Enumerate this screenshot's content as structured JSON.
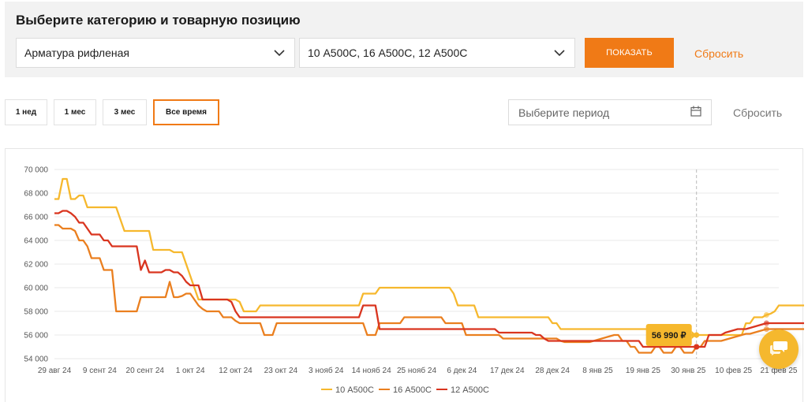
{
  "filters": {
    "title": "Выберите категорию и товарную позицию",
    "category_value": "Арматура рифленая",
    "positions_value": "10 А500С, 16 А500С, 12 А500С",
    "show_label": "ПОКАЗАТЬ",
    "reset_label": "Сбросить"
  },
  "range": {
    "buttons": [
      "1 нед",
      "1 мес",
      "3 мес",
      "Все время"
    ],
    "active": "Все время",
    "period_placeholder": "Выберите период",
    "reset_label": "Сбросить"
  },
  "icons": {
    "category_chevron": "chevron-down-icon",
    "positions_chevron": "chevron-down-icon",
    "calendar": "calendar-icon",
    "chat": "chat-icon"
  },
  "colors": {
    "accent": "#f07a16",
    "series_10": "#f6b82d",
    "series_16": "#ea7f1f",
    "series_12": "#d9351f"
  },
  "chart_data": {
    "type": "line",
    "x": [
      "29 авг 24",
      "30 авг 24",
      "31 авг 24",
      "1 сент 24",
      "2 сент 24",
      "3 сент 24",
      "4 сент 24",
      "5 сент 24",
      "6 сент 24",
      "7 сент 24",
      "8 сент 24",
      "9 сент 24",
      "10 сент 24",
      "11 сент 24",
      "12 сент 24",
      "13 сент 24",
      "14 сент 24",
      "15 сент 24",
      "16 сент 24",
      "17 сент 24",
      "18 сент 24",
      "19 сент 24",
      "20 сент 24",
      "21 сент 24",
      "22 сент 24",
      "23 сент 24",
      "24 сент 24",
      "25 сент 24",
      "26 сент 24",
      "27 сент 24",
      "28 сент 24",
      "29 сент 24",
      "30 сент 24",
      "1 окт 24",
      "2 окт 24",
      "3 окт 24",
      "4 окт 24",
      "5 окт 24",
      "6 окт 24",
      "7 окт 24",
      "8 окт 24",
      "9 окт 24",
      "10 окт 24",
      "11 окт 24",
      "12 окт 24",
      "13 окт 24",
      "14 окт 24",
      "15 окт 24",
      "16 окт 24",
      "17 окт 24",
      "18 окт 24",
      "19 окт 24",
      "20 окт 24",
      "21 окт 24",
      "22 окт 24",
      "23 окт 24",
      "24 окт 24",
      "25 окт 24",
      "26 окт 24",
      "27 окт 24",
      "28 окт 24",
      "29 окт 24",
      "30 окт 24",
      "31 окт 24",
      "1 нояб 24",
      "2 нояб 24",
      "3 нояб 24",
      "4 нояб 24",
      "5 нояб 24",
      "6 нояб 24",
      "7 нояб 24",
      "8 нояб 24",
      "9 нояб 24",
      "10 нояб 24",
      "11 нояб 24",
      "12 нояб 24",
      "13 нояб 24",
      "14 нояб 24",
      "15 нояб 24",
      "16 нояб 24",
      "17 нояб 24",
      "18 нояб 24",
      "19 нояб 24",
      "20 нояб 24",
      "21 нояб 24",
      "22 нояб 24",
      "23 нояб 24",
      "24 нояб 24",
      "25 нояб 24",
      "26 нояб 24",
      "27 нояб 24",
      "28 нояб 24",
      "29 нояб 24",
      "30 нояб 24",
      "1 дек 24",
      "2 дек 24",
      "3 дек 24",
      "4 дек 24",
      "5 дек 24",
      "6 дек 24",
      "7 дек 24",
      "8 дек 24",
      "9 дек 24",
      "10 дек 24",
      "11 дек 24",
      "12 дек 24",
      "13 дек 24",
      "14 дек 24",
      "15 дек 24",
      "16 дек 24",
      "17 дек 24",
      "18 дек 24",
      "19 дек 24",
      "20 дек 24",
      "21 дек 24",
      "22 дек 24",
      "23 дек 24",
      "24 дек 24",
      "25 дек 24",
      "26 дек 24",
      "27 дек 24",
      "28 дек 24",
      "29 дек 24",
      "30 дек 24",
      "31 дек 24",
      "1 янв 25",
      "2 янв 25",
      "3 янв 25",
      "4 янв 25",
      "5 янв 25",
      "6 янв 25",
      "7 янв 25",
      "8 янв 25",
      "9 янв 25",
      "10 янв 25",
      "11 янв 25",
      "12 янв 25",
      "13 янв 25",
      "14 янв 25",
      "15 янв 25",
      "16 янв 25",
      "17 янв 25",
      "18 янв 25",
      "19 янв 25",
      "20 янв 25",
      "21 янв 25",
      "22 янв 25",
      "23 янв 25",
      "24 янв 25",
      "25 янв 25",
      "26 янв 25",
      "27 янв 25",
      "28 янв 25",
      "29 янв 25",
      "30 янв 25",
      "31 янв 25",
      "1 фев 25",
      "2 фев 25",
      "3 фев 25",
      "4 фев 25",
      "5 фев 25",
      "6 фев 25",
      "7 фев 25",
      "8 фев 25",
      "9 фев 25",
      "10 фев 25",
      "11 фев 25",
      "12 фев 25",
      "13 фев 25",
      "14 фев 25",
      "15 фев 25",
      "16 фев 25",
      "17 фев 25",
      "18 фев 25",
      "19 фев 25",
      "20 фев 25",
      "21 фев 25"
    ],
    "x_tick_labels": [
      "29 авг 24",
      "9 сент 24",
      "20 сент 24",
      "1 окт 24",
      "12 окт 24",
      "23 окт 24",
      "3 нояб 24",
      "14 нояб 24",
      "25 нояб 24",
      "6 дек 24",
      "17 дек 24",
      "28 дек 24",
      "8 янв 25",
      "19 янв 25",
      "30 янв 25",
      "10 фев 25",
      "21 фев 25"
    ],
    "y_ticks": [
      "54 000",
      "56 000",
      "58 000",
      "60 000",
      "62 000",
      "64 000",
      "66 000",
      "68 000",
      "70 000"
    ],
    "ylim": [
      54000,
      70000
    ],
    "grid": true,
    "legend_position": "bottom",
    "series": [
      {
        "name": "10 А500С",
        "color": "#f6b82d",
        "values": [
          67500,
          67500,
          69200,
          69200,
          67500,
          67500,
          67800,
          67800,
          66800,
          66800,
          66800,
          66800,
          66800,
          66800,
          66800,
          66800,
          65800,
          64800,
          64800,
          64800,
          64800,
          64800,
          64800,
          64800,
          63200,
          63200,
          63200,
          63200,
          63200,
          63000,
          63000,
          63000,
          62000,
          61000,
          60000,
          59000,
          59000,
          59000,
          59000,
          59000,
          59000,
          59000,
          59000,
          59000,
          59000,
          58800,
          58000,
          58000,
          58000,
          58000,
          58500,
          58500,
          58500,
          58500,
          58500,
          58500,
          58500,
          58500,
          58500,
          58500,
          58500,
          58500,
          58500,
          58500,
          58500,
          58500,
          58500,
          58500,
          58500,
          58500,
          58500,
          58500,
          58500,
          58500,
          58500,
          59500,
          59500,
          59500,
          59500,
          60000,
          60000,
          60000,
          60000,
          60000,
          60000,
          60000,
          60000,
          60000,
          60000,
          60000,
          60000,
          60000,
          60000,
          60000,
          60000,
          60000,
          60000,
          59500,
          58500,
          58500,
          58500,
          58500,
          58500,
          57500,
          57500,
          57500,
          57500,
          57500,
          57500,
          57500,
          57500,
          57500,
          57500,
          57500,
          57500,
          57500,
          57500,
          57500,
          57500,
          57500,
          57500,
          57000,
          57000,
          56500,
          56500,
          56500,
          56500,
          56500,
          56500,
          56500,
          56500,
          56500,
          56500,
          56500,
          56500,
          56500,
          56500,
          56500,
          56500,
          56500,
          56500,
          56500,
          56500,
          56500,
          56500,
          56500,
          56500,
          56500,
          56500,
          56500,
          56500,
          56000,
          56000,
          56000,
          56000,
          56000,
          56000,
          56000,
          56000,
          56000,
          56000,
          56000,
          56000,
          56000,
          56000,
          56000,
          56000,
          56000,
          56990,
          56990,
          57500,
          57500,
          57500,
          57700,
          57800,
          58000,
          58500,
          58500,
          58500,
          58500,
          58500,
          58500,
          58500,
          58500,
          58500,
          58500,
          58500,
          58500,
          58500,
          58500,
          58500,
          58500,
          58500,
          58500,
          58500,
          58500,
          58500,
          58500,
          58500
        ]
      },
      {
        "name": "16 А500С",
        "color": "#ea7f1f",
        "values": [
          65300,
          65300,
          65000,
          65000,
          65000,
          64800,
          64000,
          64000,
          63500,
          62500,
          62500,
          62500,
          61500,
          61500,
          61500,
          58000,
          58000,
          58000,
          58000,
          58000,
          58000,
          59200,
          59200,
          59200,
          59200,
          59200,
          59200,
          59200,
          60500,
          59200,
          59200,
          59300,
          59500,
          59500,
          59000,
          58500,
          58200,
          58000,
          58000,
          58000,
          58000,
          57500,
          57500,
          57500,
          57200,
          57000,
          57000,
          57000,
          57000,
          57000,
          57000,
          56000,
          56000,
          56000,
          57000,
          57000,
          57000,
          57000,
          57000,
          57000,
          57000,
          57000,
          57000,
          57000,
          57000,
          57000,
          57000,
          57000,
          57000,
          57000,
          57000,
          57000,
          57000,
          57000,
          57000,
          57000,
          56000,
          56000,
          56000,
          57000,
          57000,
          57000,
          57000,
          57000,
          57000,
          57500,
          57500,
          57500,
          57500,
          57500,
          57500,
          57500,
          57500,
          57500,
          57500,
          57000,
          57000,
          57000,
          57000,
          57000,
          56000,
          56000,
          56000,
          56000,
          56000,
          56000,
          56000,
          56000,
          56000,
          55700,
          55700,
          55700,
          55700,
          55700,
          55700,
          55700,
          55700,
          55700,
          55700,
          55700,
          55700,
          55700,
          55700,
          55500,
          55400,
          55400,
          55400,
          55400,
          55400,
          55400,
          55400,
          55500,
          55600,
          55700,
          55800,
          55900,
          56000,
          56000,
          55500,
          55500,
          55000,
          55000,
          54500,
          54500,
          54500,
          54500,
          55000,
          55000,
          54500,
          54500,
          54500,
          55000,
          55000,
          54500,
          54500,
          54500,
          55000,
          55000,
          55500,
          55500,
          55500,
          55500,
          55500,
          55600,
          55700,
          55800,
          55900,
          56000,
          56100,
          56100,
          56200,
          56300,
          56400,
          56500,
          56500,
          56500,
          56500,
          56500,
          56500,
          56500,
          56500,
          56500,
          56500,
          56500,
          56500,
          56500,
          56500,
          56500,
          56500,
          56500,
          56500,
          56500,
          56500,
          56500,
          56500,
          56500
        ]
      },
      {
        "name": "12 А500С",
        "color": "#d9351f",
        "values": [
          66300,
          66300,
          66500,
          66500,
          66300,
          66000,
          65500,
          65500,
          65000,
          64500,
          64500,
          64500,
          64000,
          64000,
          63500,
          63500,
          63500,
          63500,
          63500,
          63500,
          63500,
          61500,
          62300,
          61300,
          61300,
          61300,
          61300,
          61500,
          61500,
          61300,
          61300,
          61000,
          60500,
          60200,
          60200,
          60200,
          59000,
          59000,
          59000,
          59000,
          59000,
          59000,
          59000,
          58800,
          58000,
          57500,
          57500,
          57500,
          57500,
          57500,
          57500,
          57500,
          57500,
          57500,
          57500,
          57500,
          57500,
          57500,
          57500,
          57500,
          57500,
          57500,
          57500,
          57500,
          57500,
          57500,
          57500,
          57500,
          57500,
          57500,
          57500,
          57500,
          57500,
          57500,
          57500,
          58500,
          58500,
          58500,
          58500,
          56500,
          56500,
          56500,
          56500,
          56500,
          56500,
          56500,
          56500,
          56500,
          56500,
          56500,
          56500,
          56500,
          56500,
          56500,
          56500,
          56500,
          56500,
          56500,
          56500,
          56500,
          56500,
          56500,
          56500,
          56500,
          56500,
          56500,
          56500,
          56500,
          56200,
          56200,
          56200,
          56200,
          56200,
          56200,
          56200,
          56200,
          56200,
          56000,
          56000,
          55700,
          55500,
          55500,
          55500,
          55500,
          55500,
          55500,
          55500,
          55500,
          55500,
          55500,
          55500,
          55500,
          55500,
          55500,
          55500,
          55500,
          55500,
          55500,
          55500,
          55500,
          55500,
          55500,
          55500,
          55000,
          55000,
          55000,
          55000,
          55000,
          55000,
          55000,
          55000,
          55000,
          55000,
          55000,
          55000,
          55000,
          55000,
          55000,
          55000,
          56000,
          56000,
          56000,
          56000,
          56200,
          56300,
          56400,
          56500,
          56500,
          56500,
          56600,
          56700,
          56800,
          56900,
          57000,
          57000,
          57000,
          57000,
          57000,
          57000,
          57000,
          57000,
          57000,
          57000,
          57000,
          57000,
          57000,
          57000,
          57000,
          57000,
          57000,
          57000,
          57000,
          57000,
          57000,
          57000,
          57000
        ]
      }
    ],
    "tooltip": {
      "label": "56 990 ₽",
      "series": "10 А500С"
    }
  }
}
